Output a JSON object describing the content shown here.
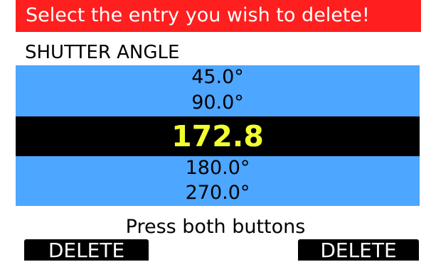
{
  "header": {
    "title": "Select the entry you wish to delete!",
    "title_bg": "#ff1f1f",
    "title_fg": "#ffffff"
  },
  "section": {
    "label": "SHUTTER ANGLE"
  },
  "list": {
    "items": [
      "45.0°",
      "90.0°",
      "172.8",
      "180.0°",
      "270.0°"
    ],
    "selected_index": 2,
    "item_bg": "#4da6ff",
    "selected_bg": "#000000",
    "selected_fg": "#f2ff2f"
  },
  "instruction": "Press both buttons",
  "buttons": {
    "left_label": "DELETE",
    "right_label": "DELETE"
  }
}
